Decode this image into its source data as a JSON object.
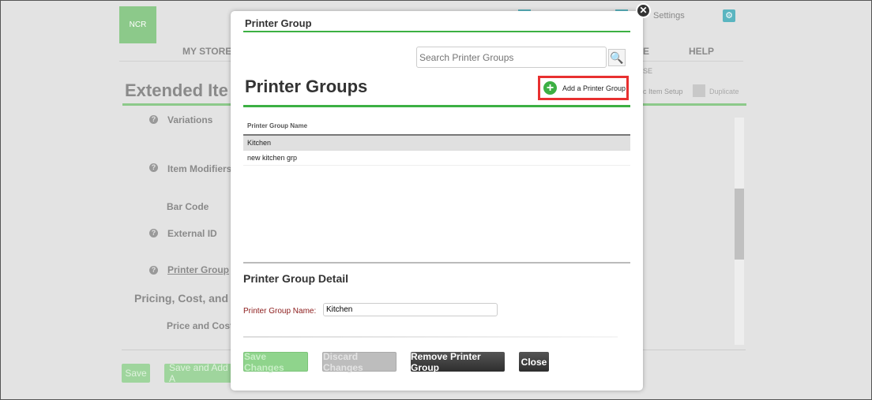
{
  "background": {
    "logo": "NCR",
    "settings": "Settings",
    "nav": {
      "my_store": "MY STORE",
      "partial": "E",
      "help": "HELP",
      "sub_partial": "SE"
    },
    "page_title": "Extended Ite",
    "toolbar": {
      "basic_item_setup": "c Item Setup",
      "duplicate": "Duplicate"
    },
    "fields": [
      {
        "label": "Variations",
        "help": true
      },
      {
        "label": "Item Modifiers",
        "help": true
      },
      {
        "label": "Bar Code",
        "help": false
      },
      {
        "label": "External ID",
        "help": true
      },
      {
        "label": "Printer Group",
        "help": true,
        "link": true
      }
    ],
    "section": "Pricing, Cost, and T",
    "price_and_cost": "Price and Cost",
    "save": "Save",
    "save_and_add": "Save and Add A"
  },
  "modal": {
    "title": "Printer Group",
    "search_placeholder": "Search Printer Groups",
    "heading": "Printer Groups",
    "add_button": "Add a Printer Group",
    "table": {
      "header": "Printer Group Name",
      "rows": [
        "Kitchen",
        "new kitchen grp"
      ],
      "selected": 0
    },
    "detail_heading": "Printer Group Detail",
    "name_label": "Printer Group Name:",
    "name_value": "Kitchen",
    "buttons": {
      "save": "Save Changes",
      "discard": "Discard Changes",
      "remove": "Remove Printer Group",
      "close": "Close"
    }
  },
  "colors": {
    "accent": "#3cb043",
    "highlight": "#e83030"
  }
}
